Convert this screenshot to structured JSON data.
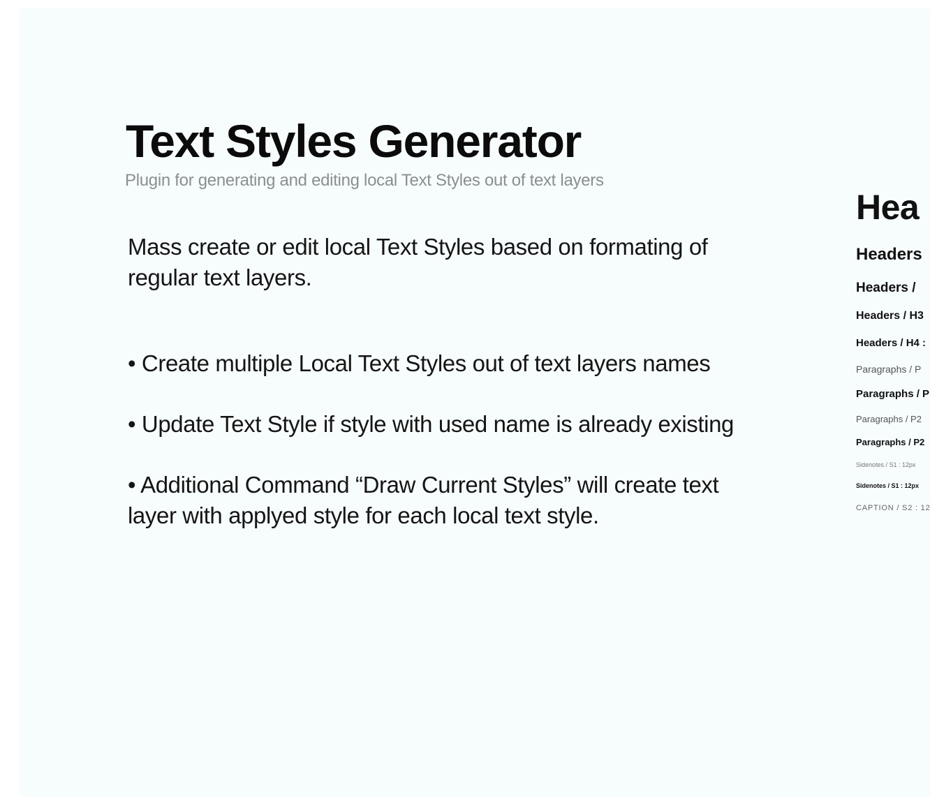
{
  "slide": {
    "title": "Text Styles Generator",
    "subtitle": "Plugin for generating and editing local Text Styles out of text layers",
    "intro": "Mass create or edit local Text Styles based on formating of regular text layers.",
    "features": [
      "• Create multiple Local Text Styles out of text layers names",
      "• Update Text Style if style with used name is already existing",
      "• Additional Command “Draw Current Styles” will create text layer with applyed style for each local text style."
    ]
  },
  "preview": {
    "items": [
      "Hea",
      "Headers",
      "Headers / ",
      "Headers / H3",
      "Headers / H4 :",
      "Paragraphs / P",
      "Paragraphs / P",
      "Paragraphs / P2",
      "Paragraphs / P2",
      "Sidenotes / S1 : 12px",
      "Sidenotes / S1 : 12px",
      "CAPTION / S2 : 12"
    ]
  },
  "colors": {
    "background": "#f7fcfd",
    "title": "#0b0b0b",
    "subtitle": "#8a8f92",
    "body": "#151515"
  }
}
